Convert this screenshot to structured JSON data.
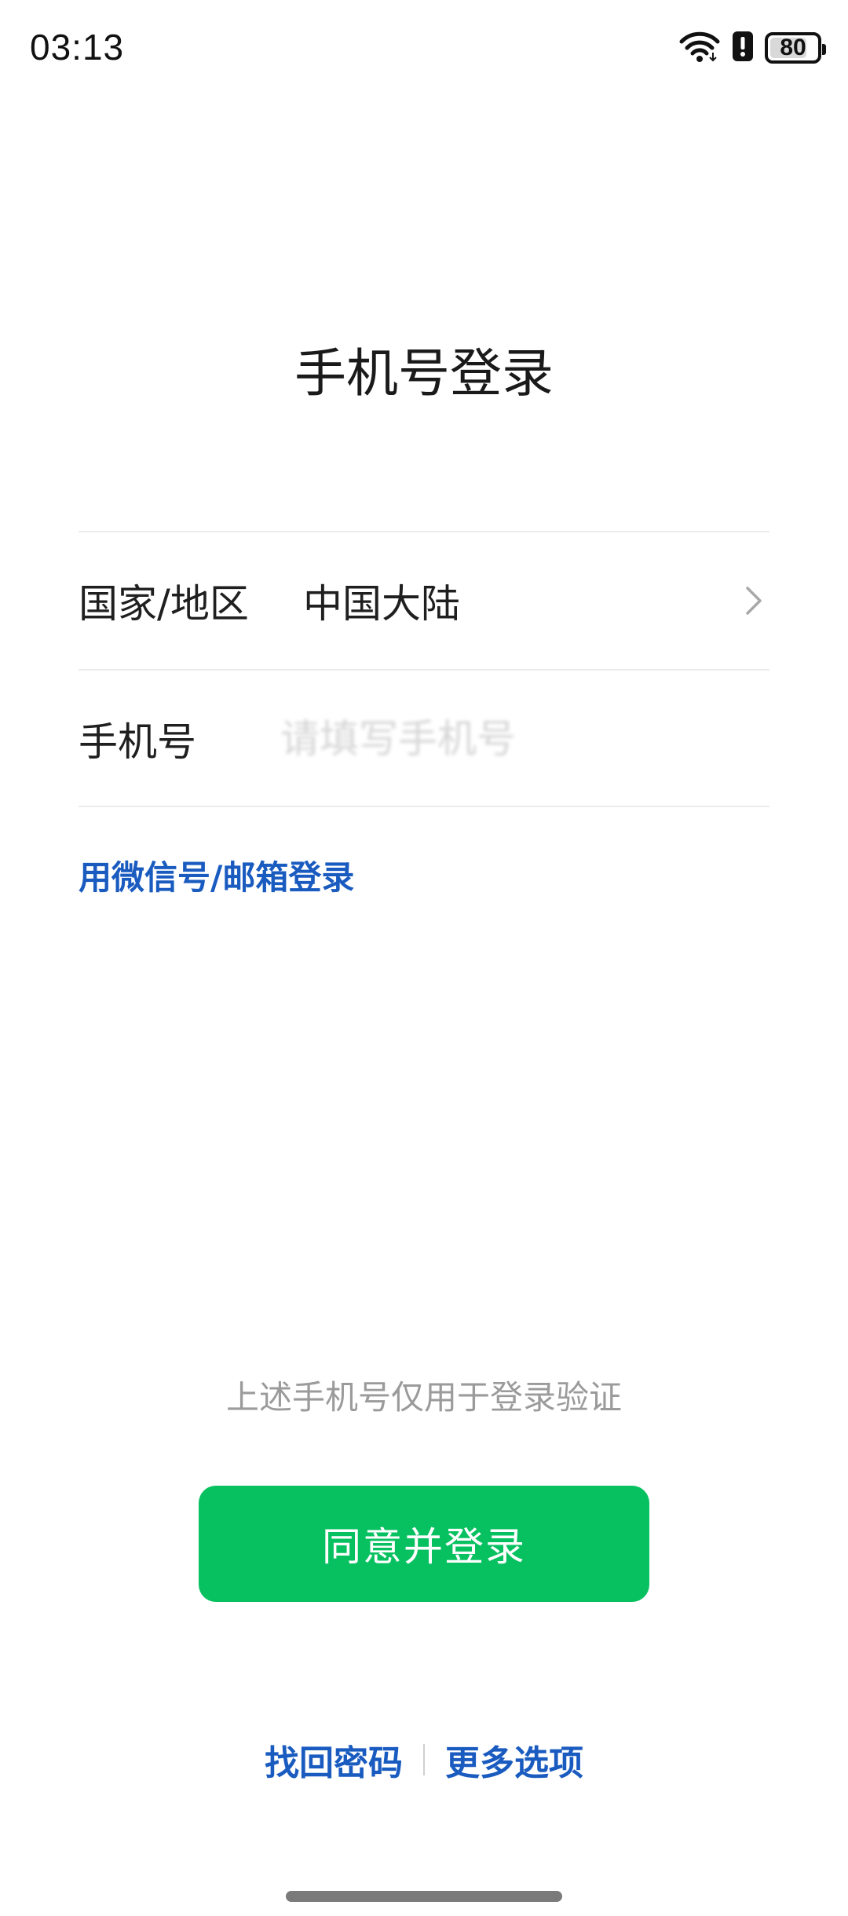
{
  "status_bar": {
    "time": "03:13",
    "battery_level": "80",
    "battery_fraction": 0.8
  },
  "title": "手机号登录",
  "region_row": {
    "label": "国家/地区",
    "value": "中国大陆",
    "icon": "chevron-right-icon"
  },
  "phone_row": {
    "label": "手机号",
    "placeholder": "请填写手机号"
  },
  "alt_login_link": "用微信号/邮箱登录",
  "hint": "上述手机号仅用于登录验证",
  "login_button": "同意并登录",
  "bottom_links": {
    "recover_password": "找回密码",
    "more_options": "更多选项"
  },
  "colors": {
    "accent_green": "#07c160",
    "link_blue": "#1a5bc0",
    "hint_gray": "#9b9b9b",
    "divider_gray": "#ececec"
  }
}
